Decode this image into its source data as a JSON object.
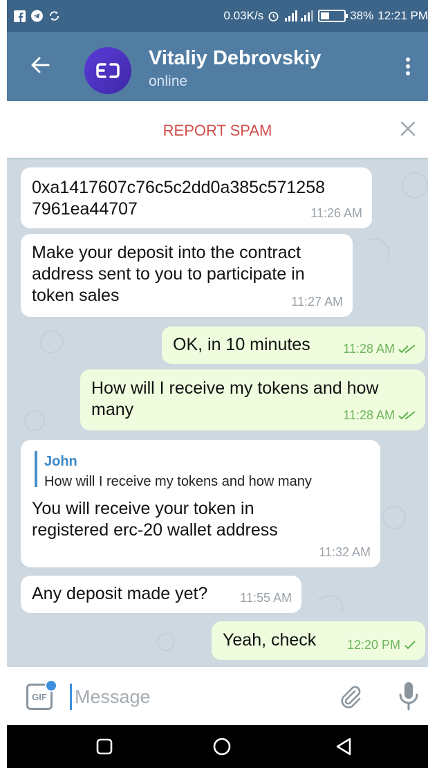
{
  "status_bar": {
    "network_speed": "0.03K/s",
    "battery_percent": "38%",
    "battery_level": 0.38,
    "time": "12:21 PM"
  },
  "header": {
    "contact_name": "Vitaliy Debrovskiy",
    "contact_status": "online"
  },
  "spam_bar": {
    "label": "REPORT SPAM"
  },
  "messages": [
    {
      "direction": "in",
      "text": "0xa1417607c76c5c2dd0a385c571258\n7961ea44707",
      "time": "11:26 AM"
    },
    {
      "direction": "in",
      "text": "Make your deposit into the contract\naddress sent to you to participate in\ntoken sales",
      "time": "11:27 AM"
    },
    {
      "direction": "out",
      "text": "OK, in 10 minutes",
      "time": "11:28 AM",
      "status": "read"
    },
    {
      "direction": "out",
      "text": "How will I receive my tokens and how\nmany",
      "time": "11:28 AM",
      "status": "read"
    },
    {
      "direction": "in",
      "reply_to": {
        "name": "John",
        "text": "How will I receive my tokens and how many"
      },
      "text": "You will receive your token in\nregistered erc-20 wallet address",
      "time": "11:32 AM"
    },
    {
      "direction": "in",
      "text": "Any deposit made yet?",
      "time": "11:55 AM"
    },
    {
      "direction": "out",
      "text": "Yeah, check",
      "time": "12:20 PM",
      "status": "sent"
    }
  ],
  "input_bar": {
    "placeholder": "Message",
    "value": ""
  },
  "colors": {
    "header": "#527da3",
    "status_bar": "#3d6589",
    "spam": "#cf4f4b",
    "outgoing_bubble": "#effdde",
    "incoming_bubble": "#ffffff",
    "accent": "#3d8fe0"
  }
}
